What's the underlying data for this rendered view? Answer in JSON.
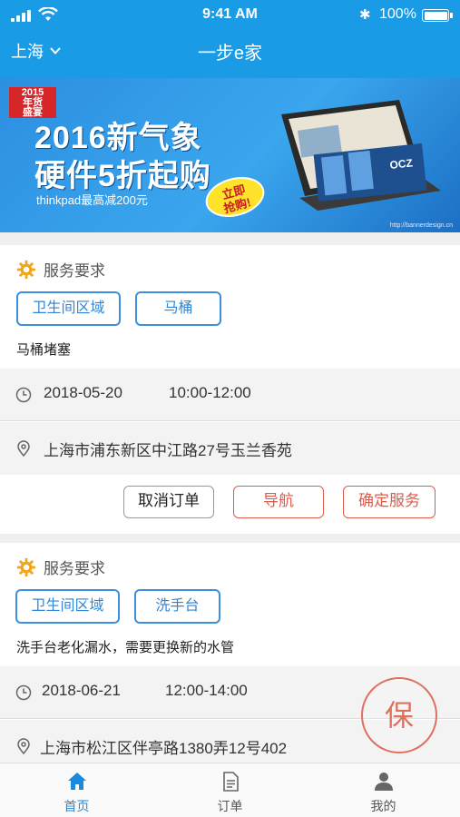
{
  "status_bar": {
    "time": "9:41 AM",
    "battery": "100%"
  },
  "header": {
    "city": "上海",
    "title": "一步e家"
  },
  "banner": {
    "badge_lines": [
      "2015",
      "年货",
      "盛宴"
    ],
    "headline_1": "2016新气象",
    "headline_2": "硬件5折起购",
    "subline": "thinkpad最高减200元",
    "sticker_lines": [
      "立即",
      "抢购!"
    ],
    "brand": "OCZ",
    "url": "http://bannerdesign.cn"
  },
  "orders": [
    {
      "section_label": "服务要求",
      "tags": [
        "卫生间区域",
        "马桶"
      ],
      "description": "马桶堵塞",
      "date": "2018-05-20",
      "time": "10:00-12:00",
      "address": "上海市浦东新区中江路27号玉兰香苑",
      "actions": {
        "cancel": "取消订单",
        "navigate": "导航",
        "confirm": "确定服务"
      }
    },
    {
      "section_label": "服务要求",
      "tags": [
        "卫生间区域",
        "洗手台"
      ],
      "description": "洗手台老化漏水，需要更换新的水管",
      "date": "2018-06-21",
      "time": "12:00-14:00",
      "address": "上海市松江区伴亭路1380弄12号402"
    }
  ],
  "seal_label": "保",
  "tabbar": {
    "items": [
      {
        "label": "首页",
        "icon": "home-icon",
        "active": true
      },
      {
        "label": "订单",
        "icon": "document-icon",
        "active": false
      },
      {
        "label": "我的",
        "icon": "person-icon",
        "active": false
      }
    ]
  },
  "colors": {
    "primary": "#1a9be6",
    "tag_blue": "#3a8fe0",
    "action_red": "#e05a4a",
    "gear_orange": "#f2a51a"
  }
}
